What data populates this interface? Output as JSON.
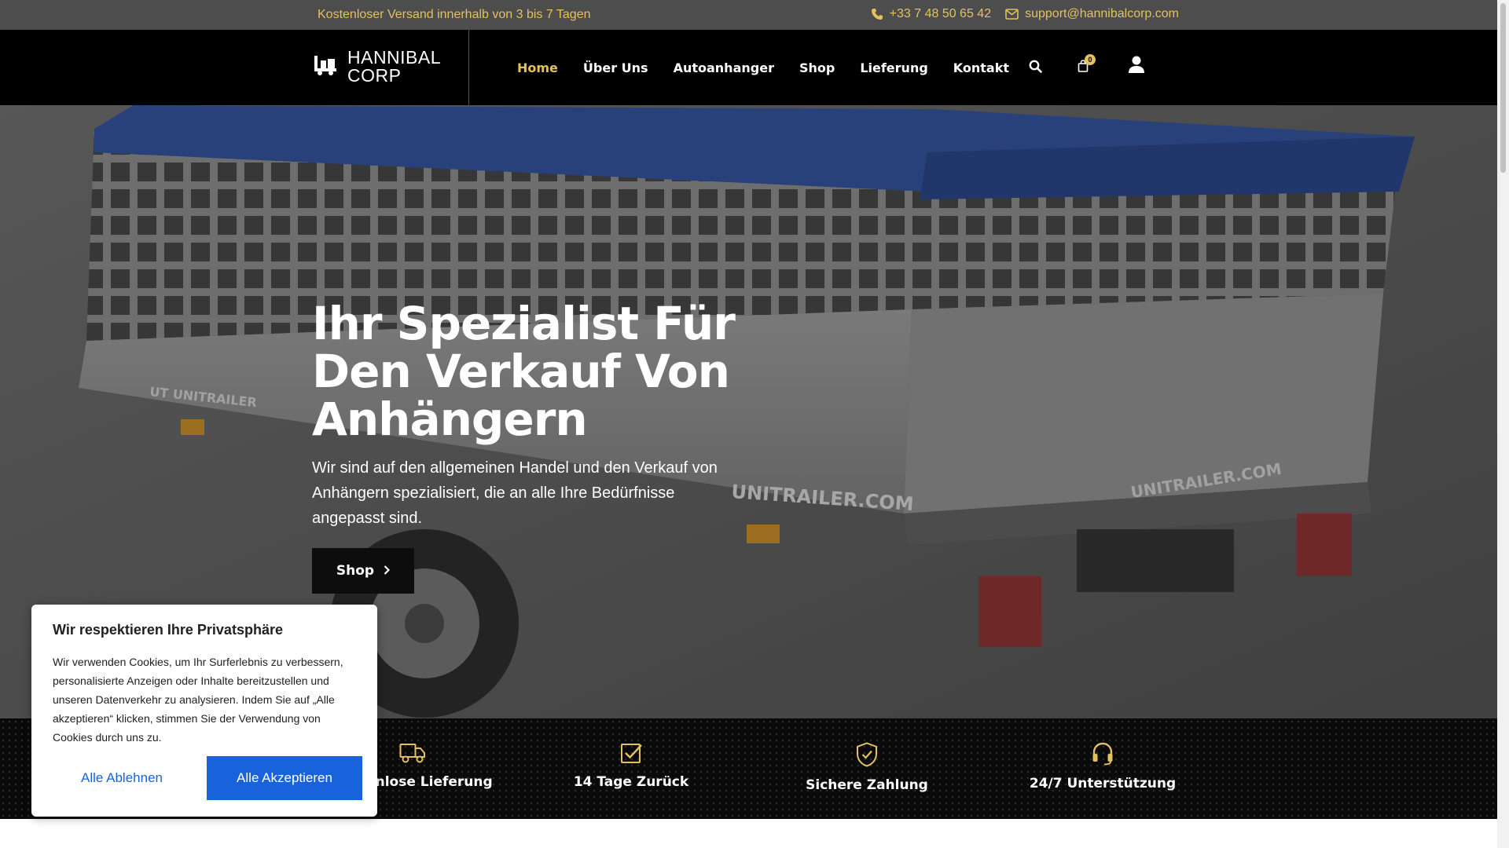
{
  "topbar": {
    "promo": "Kostenloser Versand innerhalb von 3 bis 7 Tagen",
    "phone": "+33 7 48 50 65 42",
    "email": "support@hannibalcorp.com",
    "phone_icon": "phone-icon",
    "email_icon": "envelope-icon"
  },
  "header": {
    "logo_line1": "HANNIBAL",
    "logo_line2": "CORP",
    "nav": [
      {
        "label": "Home"
      },
      {
        "label": "Über Uns"
      },
      {
        "label": "Autoanhanger"
      },
      {
        "label": "Shop"
      },
      {
        "label": "Lieferung"
      },
      {
        "label": "Kontakt"
      }
    ],
    "cart_count": "0",
    "icons": [
      "search-icon",
      "cart-icon",
      "user-icon"
    ]
  },
  "hero": {
    "title": "Ihr Spezialist Für Den Verkauf Von Anhängern",
    "text": "Wir sind auf den allgemeinen Handel und den Verkauf von Anhängern spezialisiert, die an alle Ihre Bedürfnisse angepasst sind.",
    "button": "Shop",
    "trailer_text_1": "UNITRAILER.COM",
    "trailer_text_2": "UNITRAILER.COM",
    "trailer_text_3": "UT UNITRAILER"
  },
  "features": [
    {
      "label": "Kostenlose Lieferung",
      "icon": "truck-icon"
    },
    {
      "label": "14 Tage Zurück",
      "icon": "checkbox-icon"
    },
    {
      "label": "Sichere Zahlung",
      "icon": "shield-check-icon"
    },
    {
      "label": "24/7 Unterstützung",
      "icon": "headset-icon"
    }
  ],
  "cookie": {
    "title": "Wir respektieren Ihre Privatsphäre",
    "text": "Wir verwenden Cookies, um Ihr Surferlebnis zu verbessern, personalisierte Anzeigen oder Inhalte bereitzustellen und unseren Datenverkehr zu analysieren. Indem Sie auf „Alle akzeptieren“ klicken, stimmen Sie der Verwendung von Cookies durch uns zu.",
    "reject": "Alle Ablehnen",
    "accept": "Alle Akzeptieren"
  },
  "colors": {
    "accent": "#e4c15f",
    "cookie_button": "#1863dc",
    "header_bg": "#000000",
    "topbar_bg": "#4d4d4d"
  }
}
